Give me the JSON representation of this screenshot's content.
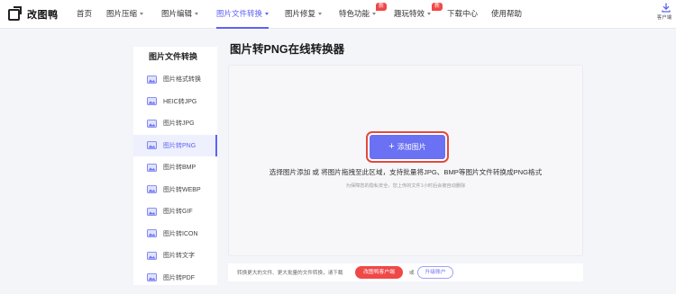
{
  "brand": {
    "name": "改图鸭",
    "logo_icon": "logo-icon"
  },
  "nav": [
    {
      "label": "首页",
      "active": false,
      "caret": false
    },
    {
      "label": "图片压缩",
      "active": false,
      "caret": true
    },
    {
      "label": "图片编辑",
      "active": false,
      "caret": true
    },
    {
      "label": "图片文件转换",
      "active": true,
      "caret": true
    },
    {
      "label": "图片修复",
      "active": false,
      "caret": true
    },
    {
      "label": "特色功能",
      "active": false,
      "caret": true,
      "badge": "新"
    },
    {
      "label": "趣玩特效",
      "active": false,
      "caret": true,
      "badge": "新"
    },
    {
      "label": "下载中心",
      "active": false,
      "caret": false
    },
    {
      "label": "使用帮助",
      "active": false,
      "caret": false
    }
  ],
  "client": {
    "label": "客户端",
    "icon": "download-icon"
  },
  "sidebar": {
    "title": "图片文件转换",
    "items": [
      {
        "label": "图片格式转换",
        "active": false
      },
      {
        "label": "HEIC转JPG",
        "active": false
      },
      {
        "label": "图片转JPG",
        "active": false
      },
      {
        "label": "图片转PNG",
        "active": true
      },
      {
        "label": "图片转BMP",
        "active": false
      },
      {
        "label": "图片转WEBP",
        "active": false
      },
      {
        "label": "图片转GIF",
        "active": false
      },
      {
        "label": "图片转ICON",
        "active": false
      },
      {
        "label": "图片转文字",
        "active": false
      },
      {
        "label": "图片转PDF",
        "active": false
      }
    ]
  },
  "main": {
    "title": "图片转PNG在线转换器",
    "add_button": "添加图片",
    "hint": "选择图片添加 或 将图片拖拽至此区域，支持批量将JPG、BMP等图片文件转换成PNG格式",
    "privacy_note": "为保障您的隐私安全，您上传的文件1小时后会被自动删除"
  },
  "bottom": {
    "text": "转换更大的文件、更大批量的文件转换，请下载",
    "download_button": "改图鸭客户端",
    "or": "或",
    "upgrade_button": "升级账户"
  },
  "colors": {
    "accent": "#5c63f2",
    "button": "#6a71f2",
    "badge": "#f04848",
    "highlight": "#e44a3c"
  }
}
